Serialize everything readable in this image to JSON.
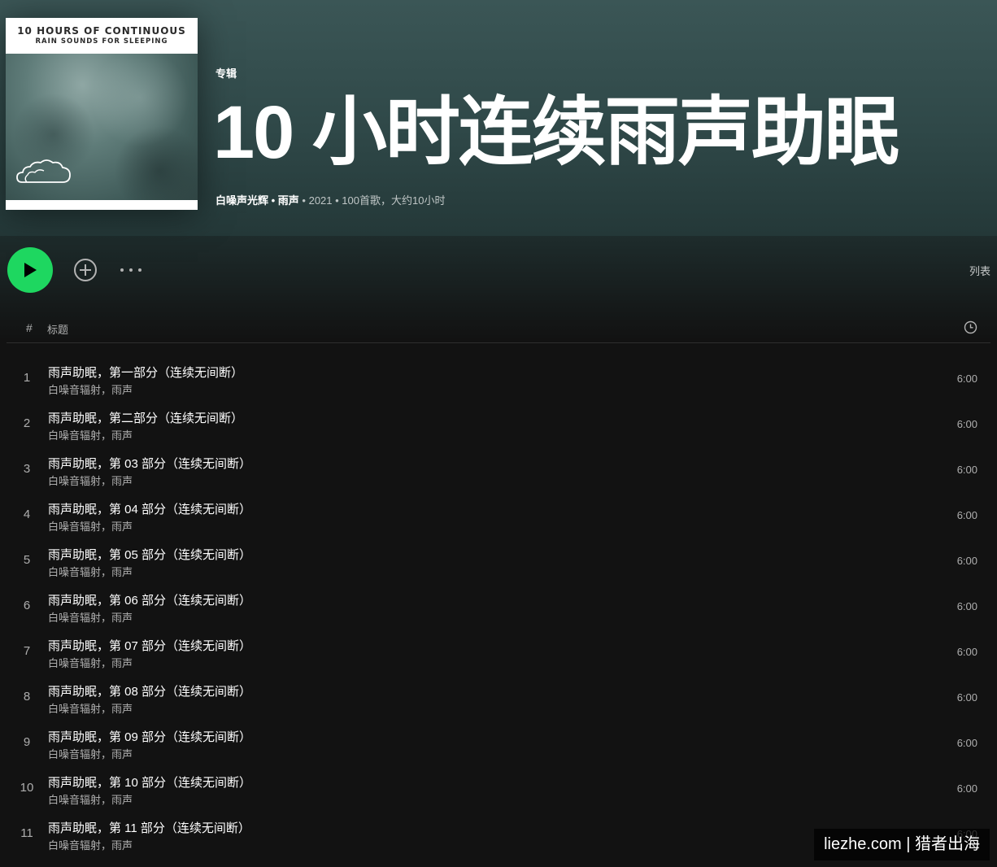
{
  "cover": {
    "line1": "10 HOURS OF CONTINUOUS",
    "line2": "RAIN SOUNDS FOR SLEEPING"
  },
  "header": {
    "type_label": "专辑",
    "title": "10 小时连续雨声助眠",
    "artist": "白噪声光辉",
    "artist2": "雨声",
    "sep": " • ",
    "year": "2021",
    "summary": "100首歌，大约10小时"
  },
  "actions": {
    "view_label": "列表"
  },
  "table": {
    "index_header": "#",
    "title_header": "标题"
  },
  "tracks": [
    {
      "index": "1",
      "title": "雨声助眠，第一部分（连续无间断）",
      "artist": "白噪音辐射，雨声",
      "duration": "6:00"
    },
    {
      "index": "2",
      "title": "雨声助眠，第二部分（连续无间断）",
      "artist": "白噪音辐射，雨声",
      "duration": "6:00"
    },
    {
      "index": "3",
      "title": "雨声助眠，第 03 部分（连续无间断）",
      "artist": "白噪音辐射，雨声",
      "duration": "6:00"
    },
    {
      "index": "4",
      "title": "雨声助眠，第 04 部分（连续无间断）",
      "artist": "白噪音辐射，雨声",
      "duration": "6:00"
    },
    {
      "index": "5",
      "title": "雨声助眠，第 05 部分（连续无间断）",
      "artist": "白噪音辐射，雨声",
      "duration": "6:00"
    },
    {
      "index": "6",
      "title": "雨声助眠，第 06 部分（连续无间断）",
      "artist": "白噪音辐射，雨声",
      "duration": "6:00"
    },
    {
      "index": "7",
      "title": "雨声助眠，第 07 部分（连续无间断）",
      "artist": "白噪音辐射，雨声",
      "duration": "6:00"
    },
    {
      "index": "8",
      "title": "雨声助眠，第 08 部分（连续无间断）",
      "artist": "白噪音辐射，雨声",
      "duration": "6:00"
    },
    {
      "index": "9",
      "title": "雨声助眠，第 09 部分（连续无间断）",
      "artist": "白噪音辐射，雨声",
      "duration": "6:00"
    },
    {
      "index": "10",
      "title": "雨声助眠，第 10 部分（连续无间断）",
      "artist": "白噪音辐射，雨声",
      "duration": "6:00"
    },
    {
      "index": "11",
      "title": "雨声助眠，第 11 部分（连续无间断）",
      "artist": "白噪音辐射，雨声",
      "duration": "6:00"
    }
  ],
  "watermark": {
    "text": "liezhe.com | 猎者出海"
  },
  "colors": {
    "accent": "#1ed760",
    "background": "#121212",
    "hero": "#3b5656"
  },
  "icons": {
    "play": "play-icon",
    "add": "add-circle-icon",
    "more": "more-horizontal-icon",
    "clock": "clock-icon",
    "cloud": "cloud-icon"
  }
}
